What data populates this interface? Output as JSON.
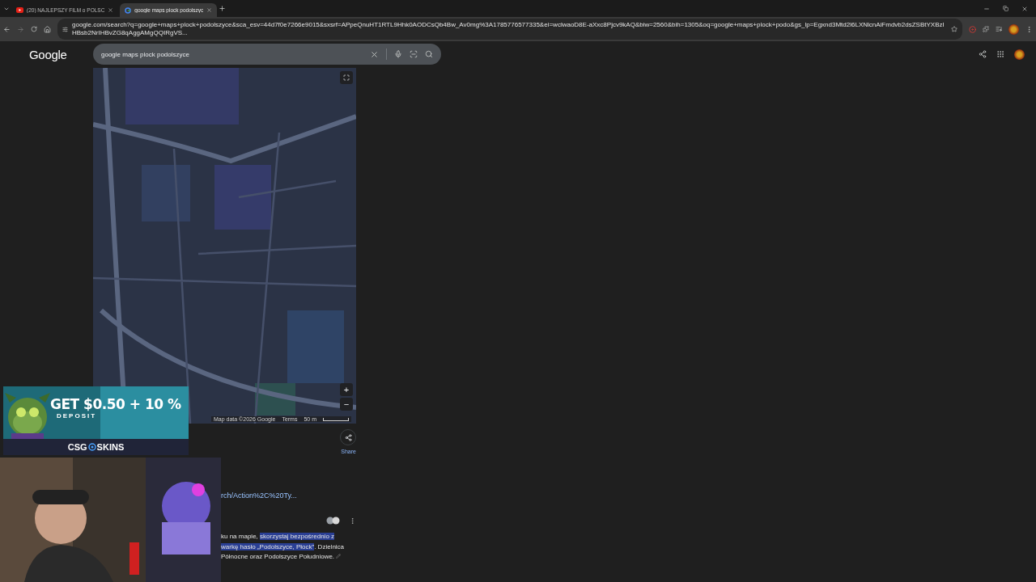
{
  "browser": {
    "tabs": [
      {
        "title": "(20) NAJLEPSZY FILM o POLSC",
        "kind": "youtube",
        "selected": false
      },
      {
        "title": "google maps plock podolszyc",
        "kind": "google",
        "selected": true
      }
    ],
    "url": "google.com/search?q=google+maps+plock+podolszyce&sca_esv=44d7f0e7266e9015&sxsrf=APpeQnuHT1RTL9Hhk0AODCsQb4Bw_Av0mg%3A1785776577335&ei=wclwaoD8E-aXxc8Pjcv9kAQ&biw=2560&bih=1305&oq=google+maps+plock+podo&gs_lp=Egxnd3Mtd2l6LXNlcnAiFmdvb2dsZSBtYXBzIHBsb2NrIHBvZG8qAggAMgQQIRgVS..."
  },
  "header": {
    "logo": "Google",
    "query": "google maps plock podolszyce"
  },
  "map": {
    "kind": "picture",
    "attribution": "Map data ©2026 Google",
    "terms": "Terms",
    "scale": "50 m",
    "zoom_in": "+",
    "zoom_out": "−"
  },
  "share": {
    "label": "Share"
  },
  "result": {
    "link": "rch/Action%2C%20Ty...",
    "lines": [
      [
        {
          "text": "ku na mapie, ",
          "highlighted": false
        },
        {
          "text": "skorzystaj bezpośrednio z",
          "highlighted": true
        }
      ],
      [
        {
          "text": "warkę hasło „Podolszyce, Płock”",
          "highlighted": true
        },
        {
          "text": ". Dzielnica",
          "highlighted": false
        }
      ],
      [
        {
          "text": "Północne oraz Podolszyce Południowe.",
          "highlighted": false
        }
      ]
    ]
  },
  "ad": {
    "headline": "GET $0.50 + 10 %",
    "subline": "DEPOSIT",
    "brand_left": "CSG",
    "brand_right": "SKINS"
  }
}
